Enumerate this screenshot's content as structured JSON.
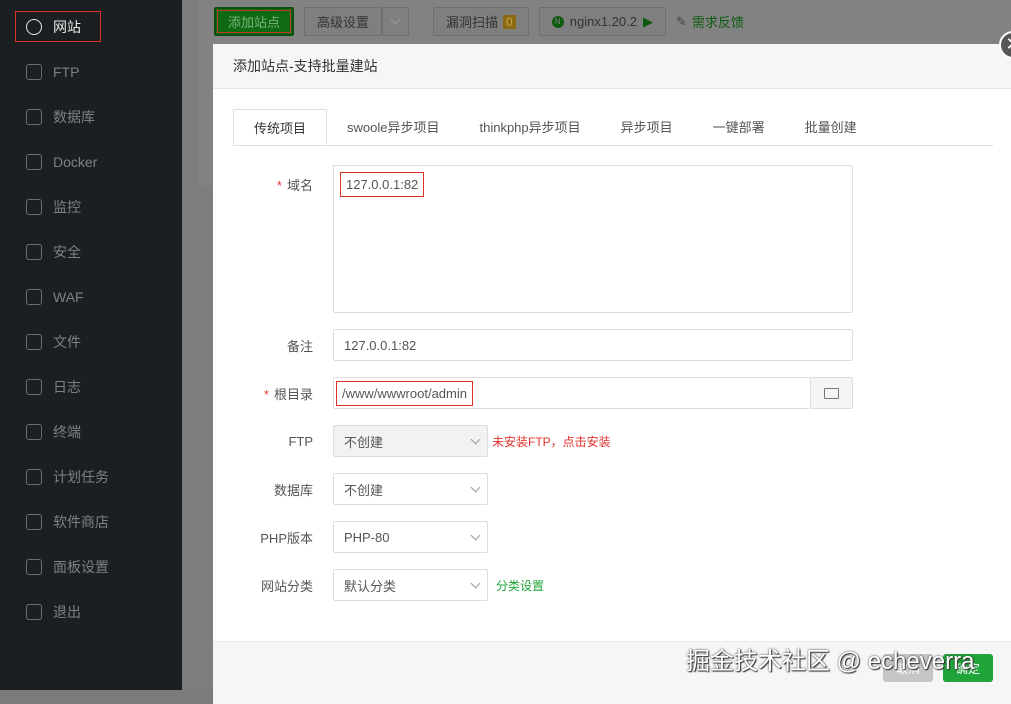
{
  "sidebar": {
    "items": [
      {
        "label": "网站",
        "icon": "globe-icon"
      },
      {
        "label": "FTP",
        "icon": "globe-icon"
      },
      {
        "label": "数据库",
        "icon": "database-icon"
      },
      {
        "label": "Docker",
        "icon": "docker-icon"
      },
      {
        "label": "监控",
        "icon": "chart-icon"
      },
      {
        "label": "安全",
        "icon": "shield-icon"
      },
      {
        "label": "WAF",
        "icon": "shield-icon"
      },
      {
        "label": "文件",
        "icon": "folder-icon"
      },
      {
        "label": "日志",
        "icon": "log-icon"
      },
      {
        "label": "终端",
        "icon": "terminal-icon"
      },
      {
        "label": "计划任务",
        "icon": "calendar-icon"
      },
      {
        "label": "软件商店",
        "icon": "grid-icon"
      },
      {
        "label": "面板设置",
        "icon": "gear-icon"
      },
      {
        "label": "退出",
        "icon": "logout-icon"
      }
    ]
  },
  "toolbar": {
    "add_site": "添加站点",
    "advanced": "高级设置",
    "scan": "漏洞扫描",
    "scan_count": "0",
    "nginx": "nginx1.20.2",
    "feedback": "需求反馈"
  },
  "dialog": {
    "title": "添加站点-支持批量建站",
    "tabs": [
      "传统项目",
      "swoole异步项目",
      "thinkphp异步项目",
      "异步项目",
      "一键部署",
      "批量创建"
    ],
    "domain_label": "域名",
    "domain_value": "127.0.0.1:82",
    "remark_label": "备注",
    "remark_value": "127.0.0.1:82",
    "root_label": "根目录",
    "root_value": "/www/wwwroot/admin",
    "ftp_label": "FTP",
    "ftp_value": "不创建",
    "ftp_hint": "未安装FTP，点击安装",
    "db_label": "数据库",
    "db_value": "不创建",
    "php_label": "PHP版本",
    "php_value": "PHP-80",
    "cat_label": "网站分类",
    "cat_value": "默认分类",
    "cat_link": "分类设置",
    "cancel": "取消",
    "confirm": "确定"
  },
  "watermark": "掘金技术社区 @ echeverra"
}
